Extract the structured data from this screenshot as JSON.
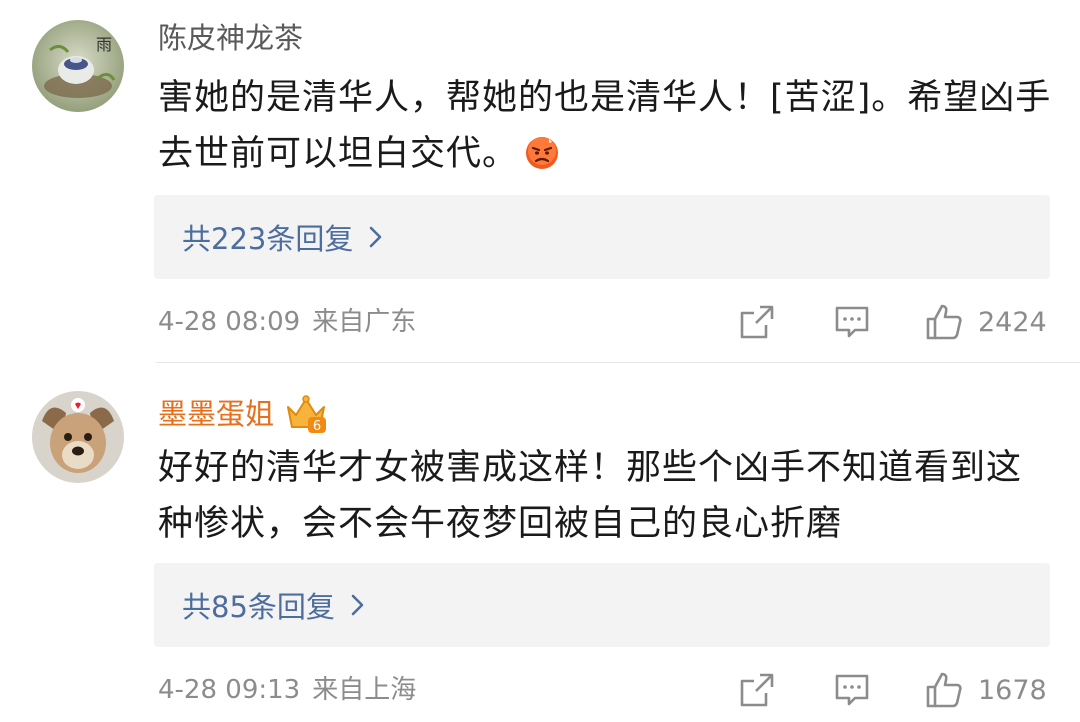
{
  "comments": [
    {
      "username": "陈皮神龙茶",
      "body": "害她的是清华人，帮她的也是清华人！[苦涩]。希望凶手去世前可以坦白交代。",
      "emoji_icon": "angry-face-icon",
      "replies_label": "共223条回复",
      "time": "4-28 08:09",
      "location": "来自广东",
      "likes": "2424",
      "avatar_icon": "tea-set-avatar"
    },
    {
      "username": "墨墨蛋姐",
      "vip_badge": "crown-vip-badge",
      "vip_level": "6",
      "body": "好好的清华才女被害成这样！那些个凶手不知道看到这种惨状，会不会午夜梦回被自己的良心折磨",
      "replies_label": "共85条回复",
      "time": "4-28 09:13",
      "location": "来自上海",
      "likes": "1678",
      "avatar_icon": "dog-avatar"
    }
  ],
  "colors": {
    "username_default": "#5a5a5a",
    "username_vip": "#e86f1c",
    "link_blue": "#4d6d9e",
    "reply_bg": "#f3f3f3",
    "meta_gray": "#8c8c8c"
  },
  "icons": {
    "share": "share-icon",
    "comment": "comment-icon",
    "like": "thumbs-up-icon",
    "chevron": "chevron-right-icon"
  }
}
